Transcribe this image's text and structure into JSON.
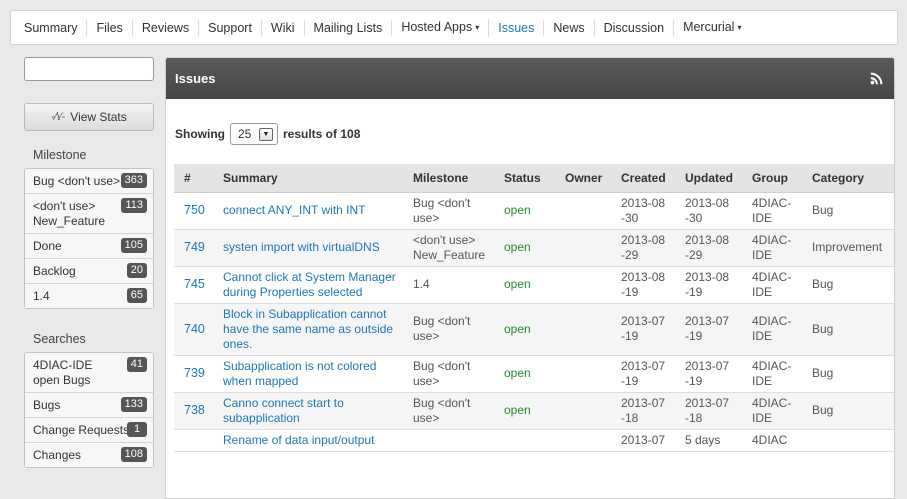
{
  "nav": [
    {
      "label": "Summary"
    },
    {
      "label": "Files"
    },
    {
      "label": "Reviews"
    },
    {
      "label": "Support"
    },
    {
      "label": "Wiki"
    },
    {
      "label": "Mailing Lists"
    },
    {
      "label": "Hosted Apps",
      "caret": "▾"
    },
    {
      "label": "Issues",
      "active": true
    },
    {
      "label": "News"
    },
    {
      "label": "Discussion"
    },
    {
      "label": "Mercurial",
      "caret": "▾"
    }
  ],
  "sidebar": {
    "search_value": "",
    "view_stats_label": "View Stats",
    "view_stats_icon": "pulse-icon",
    "milestone_heading": "Milestone",
    "milestones": [
      {
        "label": "Bug <don't use>",
        "count": "363"
      },
      {
        "label": "<don't use> New_Feature",
        "count": "113"
      },
      {
        "label": "Done",
        "count": "105"
      },
      {
        "label": "Backlog",
        "count": "20"
      },
      {
        "label": "1.4",
        "count": "65"
      }
    ],
    "searches_heading": "Searches",
    "searches": [
      {
        "label": "4DIAC-IDE open Bugs",
        "count": "41"
      },
      {
        "label": "Bugs",
        "count": "133"
      },
      {
        "label": "Change Requests",
        "count": "1"
      },
      {
        "label": "Changes",
        "count": "108"
      }
    ]
  },
  "main": {
    "title": "Issues",
    "rss_icon": "rss-icon",
    "showing_label": "Showing",
    "per_page": "25",
    "results_label": "results of 108",
    "columns": [
      "#",
      "Summary",
      "Milestone",
      "Status",
      "Owner",
      "Created",
      "Updated",
      "Group",
      "Category"
    ],
    "rows": [
      {
        "num": "750",
        "summary": "connect ANY_INT with INT",
        "milestone": "Bug <don't use>",
        "status": "open",
        "owner": "",
        "created": "2013-08 -30",
        "updated": "2013-08 -30",
        "group": "4DIAC-IDE",
        "category": "Bug"
      },
      {
        "num": "749",
        "summary": "systen import with virtualDNS",
        "milestone": "<don't use> New_Feature",
        "status": "open",
        "owner": "",
        "created": "2013-08 -29",
        "updated": "2013-08 -29",
        "group": "4DIAC-IDE",
        "category": "Improvement"
      },
      {
        "num": "745",
        "summary": "Cannot click at System Manager during Properties selected",
        "milestone": "1.4",
        "status": "open",
        "owner": "",
        "created": "2013-08 -19",
        "updated": "2013-08 -19",
        "group": "4DIAC-IDE",
        "category": "Bug"
      },
      {
        "num": "740",
        "summary": "Block in Subapplication cannot have the same name as outside ones.",
        "milestone": "Bug <don't use>",
        "status": "open",
        "owner": "",
        "created": "2013-07 -19",
        "updated": "2013-07 -19",
        "group": "4DIAC-IDE",
        "category": "Bug"
      },
      {
        "num": "739",
        "summary": "Subapplication is not colored when mapped",
        "milestone": "Bug <don't use>",
        "status": "open",
        "owner": "",
        "created": "2013-07 -19",
        "updated": "2013-07 -19",
        "group": "4DIAC-IDE",
        "category": "Bug"
      },
      {
        "num": "738",
        "summary": "Canno connect start to subapplication",
        "milestone": "Bug <don't use>",
        "status": "open",
        "owner": "",
        "created": "2013-07 -18",
        "updated": "2013-07 -18",
        "group": "4DIAC-IDE",
        "category": "Bug"
      },
      {
        "num": "",
        "summary": "Rename of data input/output",
        "milestone": "",
        "status": "",
        "owner": "",
        "created": "2013-07",
        "updated": "5 days",
        "group": "4DIAC",
        "category": ""
      }
    ]
  }
}
